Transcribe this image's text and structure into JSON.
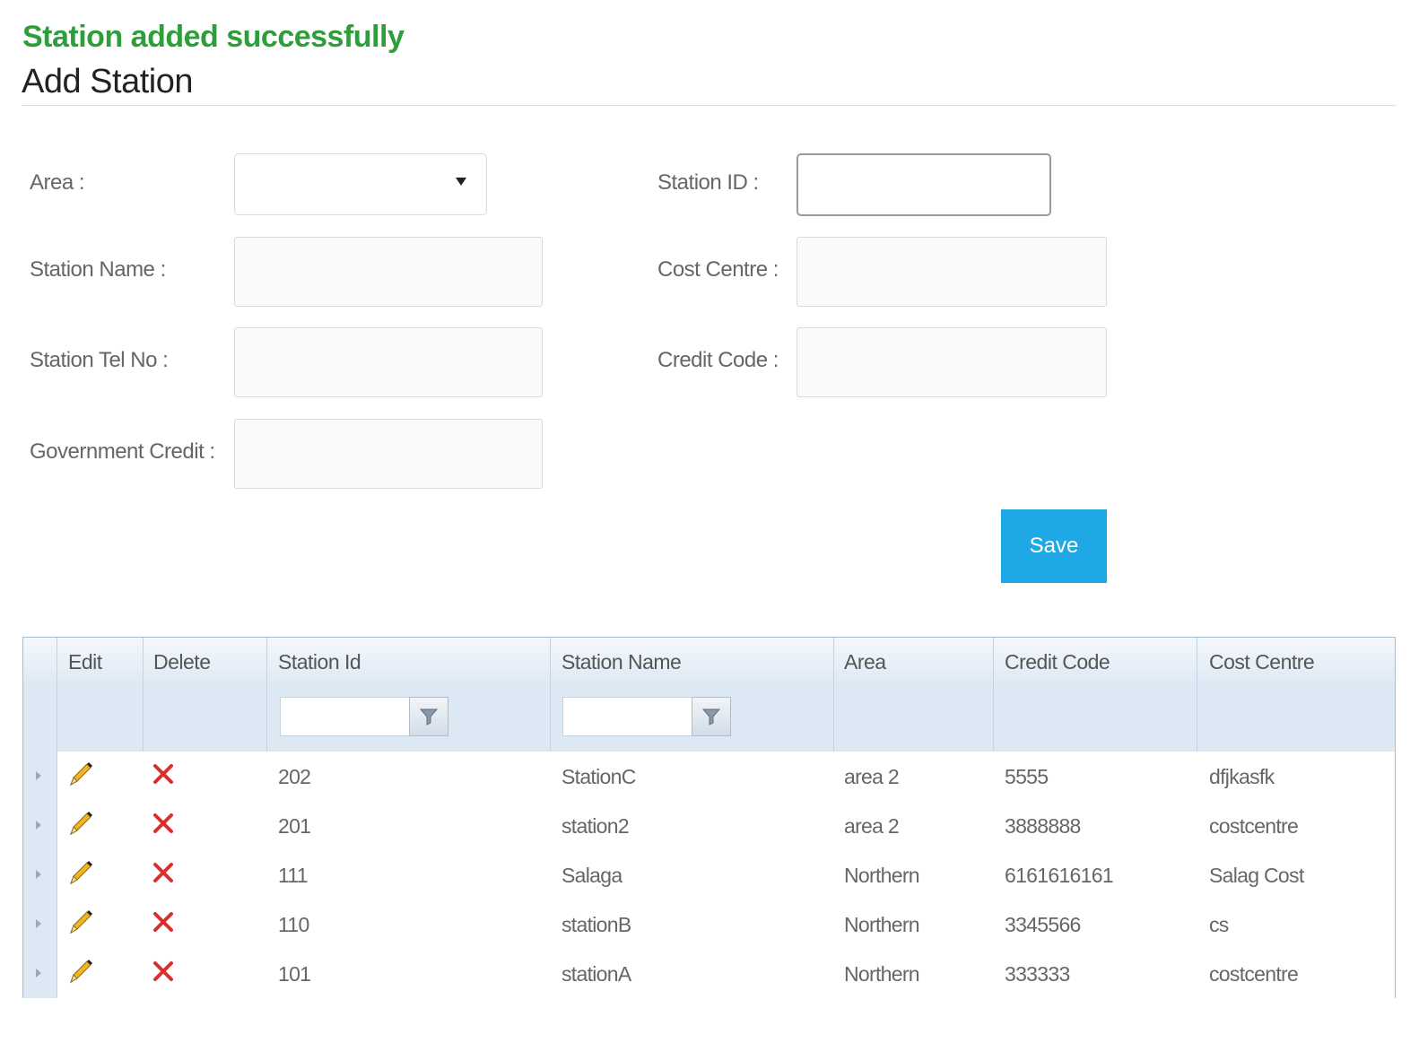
{
  "message": "Station added successfully",
  "page_title": "Add Station",
  "form": {
    "area": {
      "label": "Area :",
      "value": ""
    },
    "station_id": {
      "label": "Station ID :",
      "value": ""
    },
    "station_name": {
      "label": "Station Name :",
      "value": ""
    },
    "cost_centre": {
      "label": "Cost Centre :",
      "value": ""
    },
    "station_tel_no": {
      "label": "Station Tel No :",
      "value": ""
    },
    "credit_code": {
      "label": "Credit Code :",
      "value": ""
    },
    "government_credit": {
      "label": "Government Credit :",
      "value": ""
    },
    "save_label": "Save"
  },
  "grid": {
    "columns": [
      "Edit",
      "Delete",
      "Station Id",
      "Station Name",
      "Area",
      "Credit Code",
      "Cost Centre"
    ],
    "rows": [
      {
        "station_id": "202",
        "station_name": "StationC",
        "area": "area 2",
        "credit_code": "5555",
        "cost_centre": "dfjkasfk"
      },
      {
        "station_id": "201",
        "station_name": "station2",
        "area": "area 2",
        "credit_code": "3888888",
        "cost_centre": "costcentre"
      },
      {
        "station_id": "111",
        "station_name": "Salaga",
        "area": "Northern",
        "credit_code": "6161616161",
        "cost_centre": "Salag Cost"
      },
      {
        "station_id": "110",
        "station_name": "stationB",
        "area": "Northern",
        "credit_code": "3345566",
        "cost_centre": "cs"
      },
      {
        "station_id": "101",
        "station_name": "stationA",
        "area": "Northern",
        "credit_code": "333333",
        "cost_centre": "costcentre"
      }
    ]
  },
  "icons": {
    "edit": "pencil-icon",
    "delete": "red-x-icon",
    "filter": "funnel-icon",
    "dropdown": "triangle-down-icon",
    "expand": "triangle-right-icon"
  },
  "colors": {
    "success": "#2e9e3a",
    "save_button": "#1fa8e6",
    "grid_header": "#dde8f5",
    "delete": "#d9302c"
  }
}
